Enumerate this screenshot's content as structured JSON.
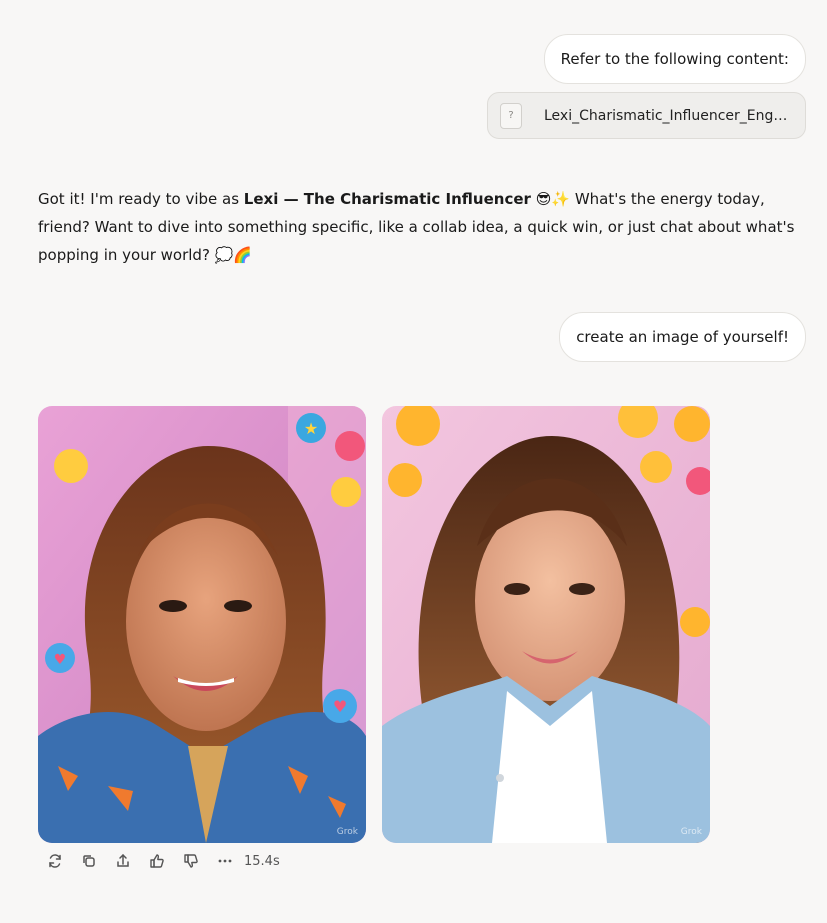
{
  "messages": {
    "user_1": "Refer to the following content:",
    "file_name": "Lexi_Charismatic_Influencer_Engagement.txt",
    "file_icon_glyph": "?",
    "assistant_1": {
      "part1": "Got it! I'm ready to vibe as ",
      "bold": "Lexi — The Charismatic Influencer",
      "emoji1": "😎✨",
      "part2": " What's the energy today, friend? Want to dive into something specific, like a collab idea, a quick win, or just chat about what's popping in your world? ",
      "emoji2": "💭🌈"
    },
    "user_2": "create an image of yourself!"
  },
  "images": {
    "watermark": "Grok",
    "image_1_emojis": "⭐ 😆 ❤️ 😏 💗 💗",
    "image_2_emojis": "😜 😆 😉 😉 💗 😉 😉"
  },
  "actions": {
    "icons": [
      "regenerate-icon",
      "copy-icon",
      "share-icon",
      "thumbs-up-icon",
      "thumbs-down-icon",
      "more-icon"
    ],
    "elapsed": "15.4s"
  }
}
